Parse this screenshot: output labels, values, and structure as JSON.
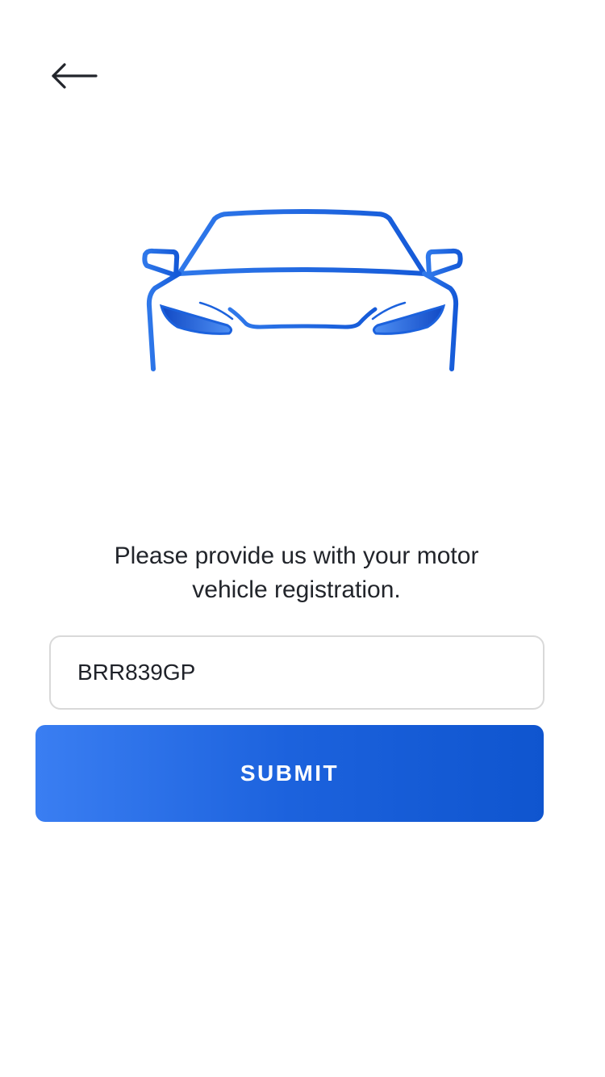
{
  "header": {
    "back_icon": "arrow-left-icon"
  },
  "hero": {
    "icon": "car-front-icon",
    "accent_color": "#1f63df"
  },
  "form": {
    "prompt": "Please provide us with your motor vehicle registration.",
    "registration_value": "BRR839GP",
    "submit_label": "SUBMIT"
  }
}
